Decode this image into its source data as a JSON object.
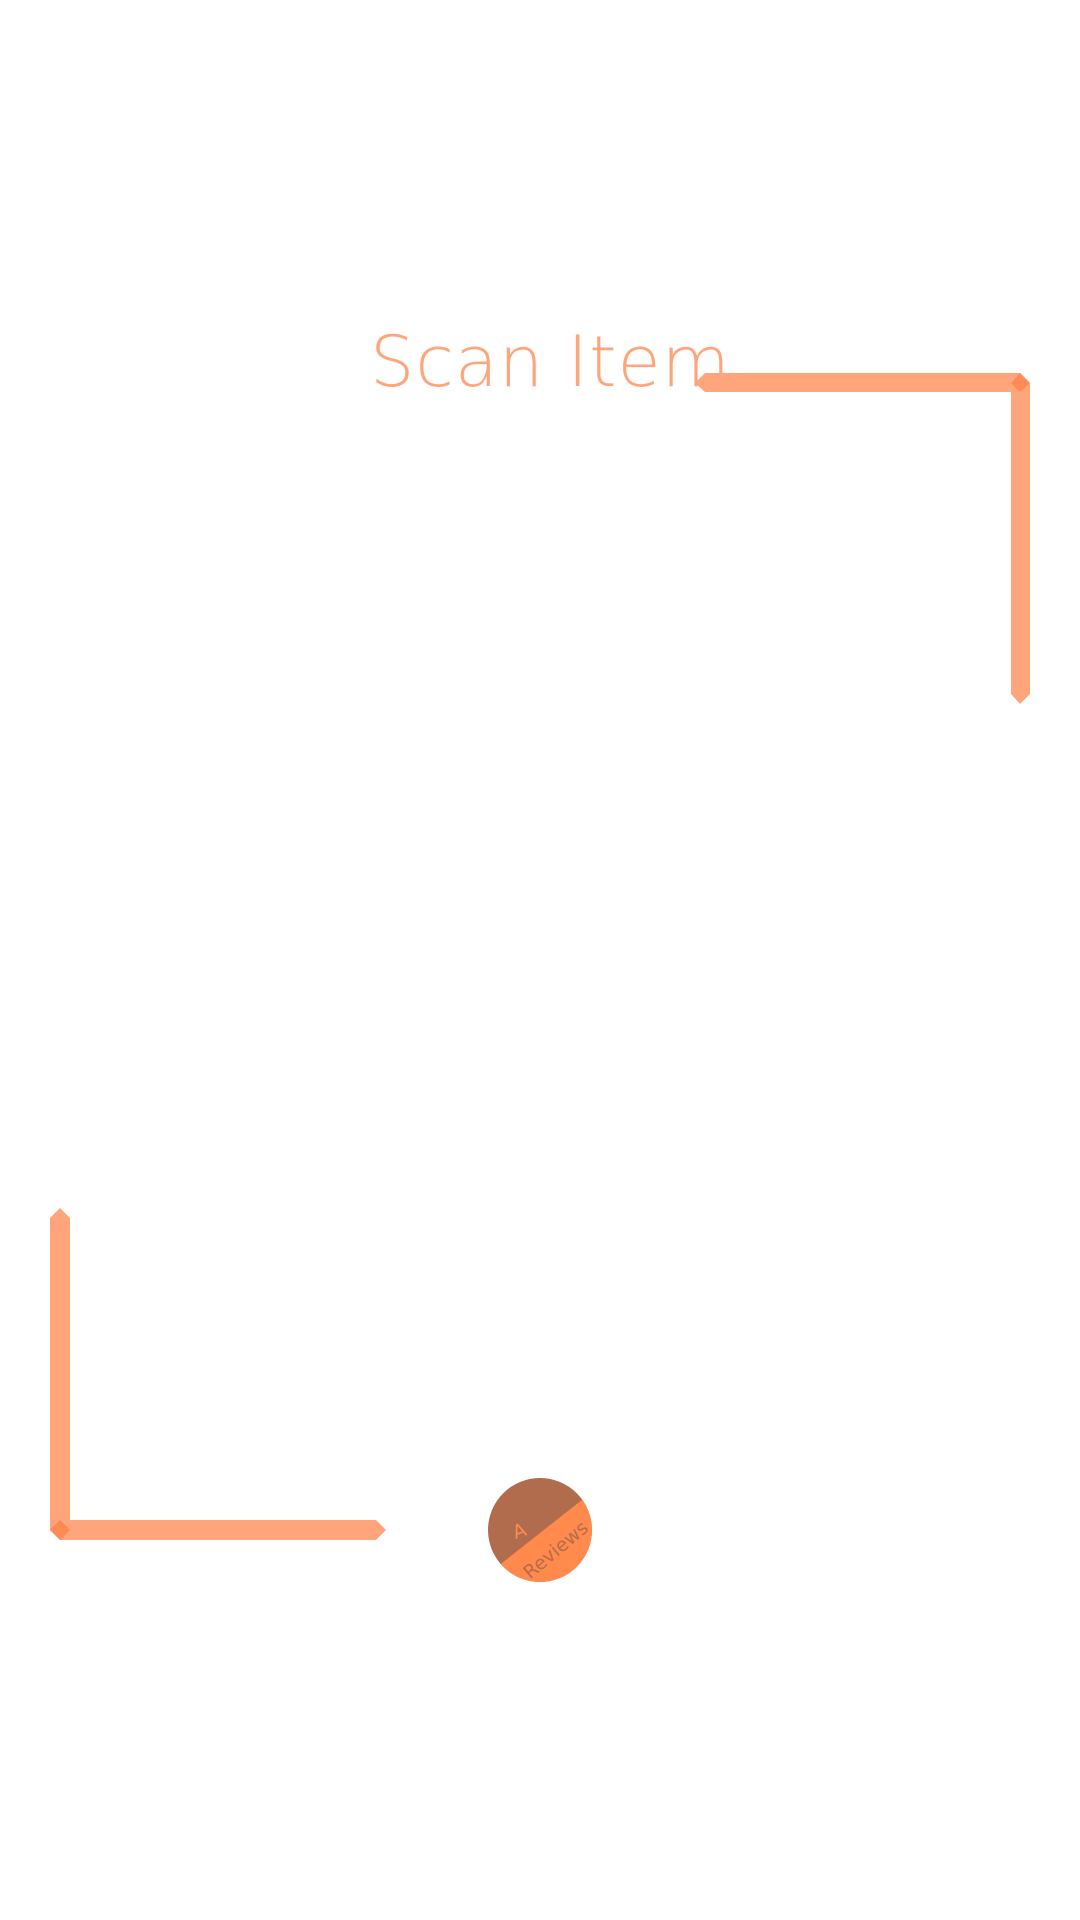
{
  "screen": {
    "title": "Scan Item"
  },
  "colors": {
    "accent": "#FFA57C",
    "accent_dark": "#FF8A55",
    "badge_top": "#B06C4C",
    "badge_bottom": "#FF8A4C",
    "badge_text": "#B56C4C"
  },
  "badge": {
    "letter": "A",
    "label": "Reviews"
  }
}
